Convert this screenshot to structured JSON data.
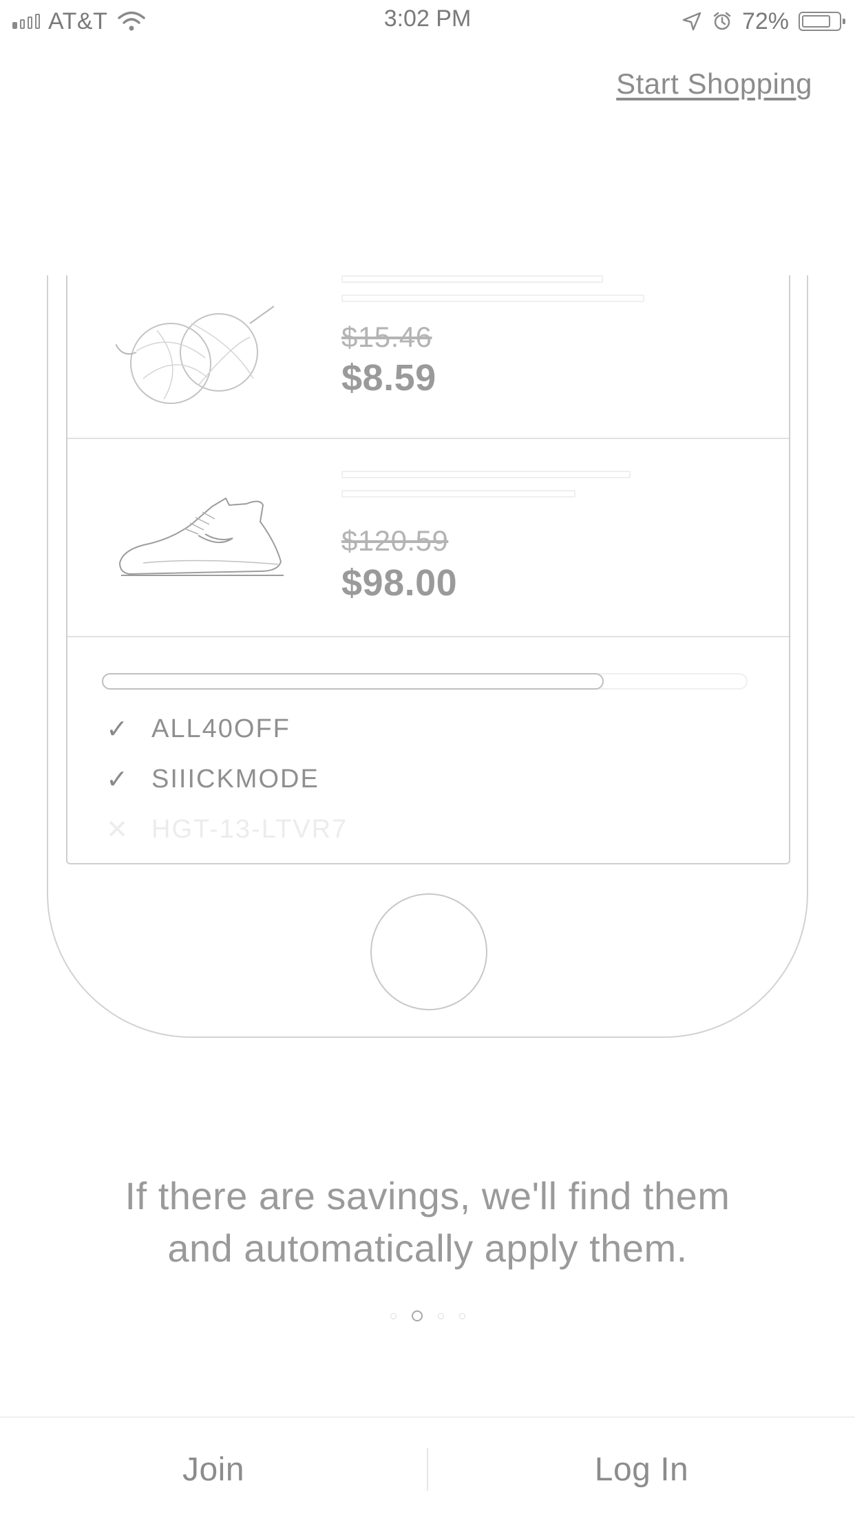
{
  "status_bar": {
    "carrier": "AT&T",
    "time": "3:02 PM",
    "battery_pct": "72%",
    "icons": [
      "signal-icon",
      "wifi-icon",
      "location-icon",
      "alarm-icon",
      "battery-icon"
    ]
  },
  "header": {
    "start_shopping": "Start Shopping"
  },
  "phone_illustration": {
    "products": [
      {
        "image": "yarn-icon",
        "old_price": "$15.46",
        "new_price": "$8.59"
      },
      {
        "image": "sneaker-icon",
        "old_price": "$120.59",
        "new_price": "$98.00"
      }
    ],
    "progress": 0.78,
    "codes": [
      {
        "status": "applied",
        "icon": "check-icon",
        "code": "ALL40OFF"
      },
      {
        "status": "applied",
        "icon": "check-icon",
        "code": "SIIICKMODE"
      },
      {
        "status": "failed",
        "icon": "x-icon",
        "code": "HGT-13-LTVR7"
      }
    ]
  },
  "caption": {
    "line1": "If there are savings, we'll find them",
    "line2": "and automatically apply them."
  },
  "pager": {
    "count": 4,
    "active_index": 1
  },
  "footer": {
    "join_label": "Join",
    "login_label": "Log In"
  }
}
